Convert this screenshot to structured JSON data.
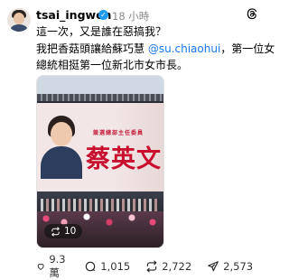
{
  "post": {
    "username": "tsai_ingwen",
    "time": "18 小時",
    "text_line1": "這一次，又是誰在惡搞我？",
    "text_line2_before": "我把香菇頭讓給蘇巧慧 ",
    "text_line2_mention": "@su.chiaohui",
    "text_line2_after": "，第一位女",
    "text_line3": "總統相挺第一位新北市女市長。"
  },
  "image": {
    "banner_subtitle": "競選總部主任委員",
    "banner_name": "蔡英文",
    "repost_count": "10"
  },
  "actions": {
    "likes": "9.3萬",
    "comments": "1,015",
    "reposts": "2,722",
    "shares": "2,573"
  },
  "colors": {
    "mention": "#1877f2",
    "verified": "#1d9bf0",
    "banner_red": "#c8102e"
  }
}
